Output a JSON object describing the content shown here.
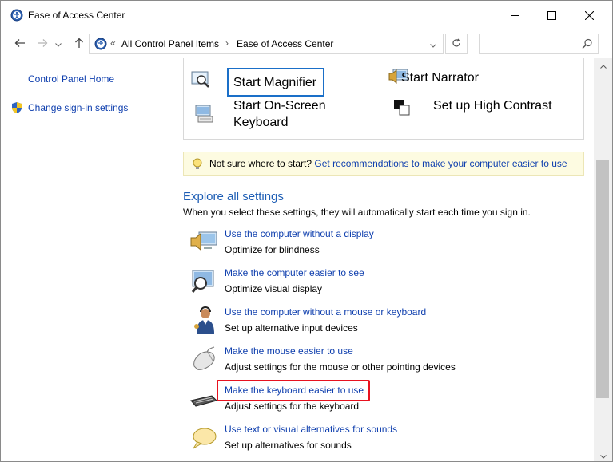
{
  "window": {
    "title": "Ease of Access Center",
    "icon": "ease-of-access-icon",
    "minimize_icon": "minimize-icon",
    "maximize_icon": "maximize-icon",
    "close_icon": "close-icon"
  },
  "nav": {
    "back_icon": "back-arrow-icon",
    "forward_icon": "forward-arrow-icon",
    "recent_icon": "chevron-down-icon",
    "up_icon": "up-arrow-icon",
    "breadcrumb_separator": "«",
    "breadcrumbs": [
      "All Control Panel Items",
      "Ease of Access Center"
    ],
    "crumb_separator": "›",
    "refresh_icon": "refresh-icon",
    "search_placeholder": "",
    "search_icon": "search-icon"
  },
  "sidebar": {
    "items": [
      {
        "label": "Control Panel Home"
      },
      {
        "label": "Change sign-in settings",
        "icon": "shield-icon"
      }
    ]
  },
  "quick_access": {
    "items": [
      {
        "label": "Start Magnifier",
        "icon": "magnifier-icon"
      },
      {
        "label": "Start Narrator",
        "icon": "narrator-icon"
      },
      {
        "label_line1": "Start On-Screen",
        "label_line2": "Keyboard",
        "icon": "on-screen-keyboard-icon"
      },
      {
        "label": "Set up High Contrast",
        "icon": "high-contrast-icon"
      }
    ]
  },
  "tip": {
    "icon": "lightbulb-icon",
    "text": "Not sure where to start?",
    "link": "Get recommendations to make your computer easier to use"
  },
  "explore": {
    "title": "Explore all settings",
    "description": "When you select these settings, they will automatically start each time you sign in.",
    "settings": [
      {
        "link": "Use the computer without a display",
        "desc": "Optimize for blindness",
        "icon": "monitor-speaker-icon"
      },
      {
        "link": "Make the computer easier to see",
        "desc": "Optimize visual display",
        "icon": "monitor-magnify-icon"
      },
      {
        "link": "Use the computer without a mouse or keyboard",
        "desc": "Set up alternative input devices",
        "icon": "person-headset-icon"
      },
      {
        "link": "Make the mouse easier to use",
        "desc": "Adjust settings for the mouse or other pointing devices",
        "icon": "mouse-icon"
      },
      {
        "link": "Make the keyboard easier to use",
        "desc": "Adjust settings for the keyboard",
        "icon": "keyboard-icon"
      },
      {
        "link": "Use text or visual alternatives for sounds",
        "desc": "Set up alternatives for sounds",
        "icon": "speech-bubble-icon"
      }
    ]
  },
  "colors": {
    "link": "#0f3fae",
    "section_title": "#1e5eb5",
    "highlight_border": "#e8121f",
    "focus_border": "#1a6fc8",
    "tip_background": "#fdfbe1"
  }
}
